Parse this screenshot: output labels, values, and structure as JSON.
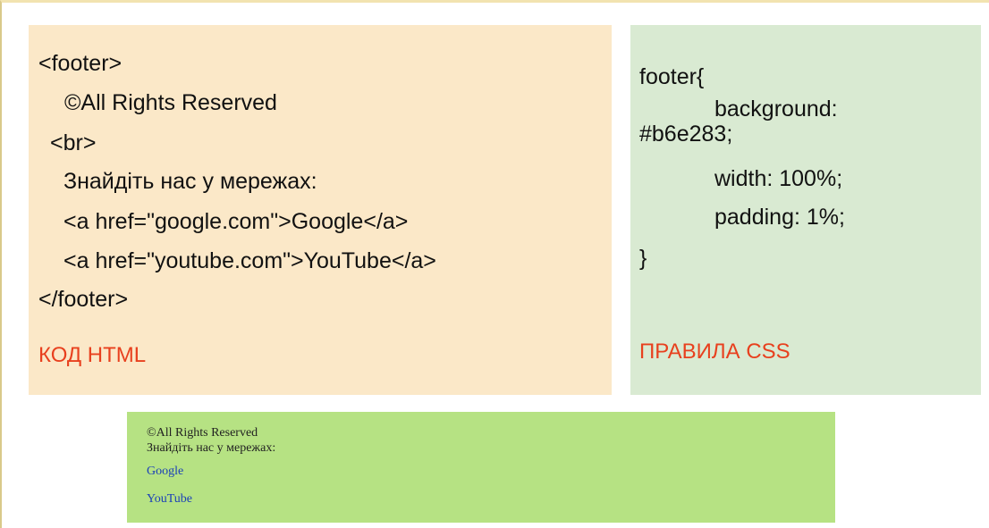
{
  "html_panel": {
    "lines": [
      "<footer>",
      "©All Rights Reserved",
      "<br>",
      "Знайдіть нас у мережах:",
      "<a href=\"google.com\">Google</a>",
      "<a href=\"youtube.com\">YouTube</a>",
      "</footer>"
    ],
    "caption": "КОД HTML"
  },
  "css_panel": {
    "lines": [
      "footer{",
      "background:",
      "#b6e283;",
      "width: 100%;",
      "padding: 1%;",
      "}"
    ],
    "caption": "ПРАВИЛА CSS"
  },
  "demo_footer": {
    "copyright": "©All Rights Reserved",
    "find_us": "Знайдіть нас у мережах:",
    "links": [
      "Google",
      "YouTube"
    ],
    "background": "#b6e283",
    "link_color": "#1a3fb8"
  },
  "colors": {
    "html_panel_bg": "#fbe8c8",
    "css_panel_bg": "#d9ead2",
    "caption": "#e8401e"
  }
}
